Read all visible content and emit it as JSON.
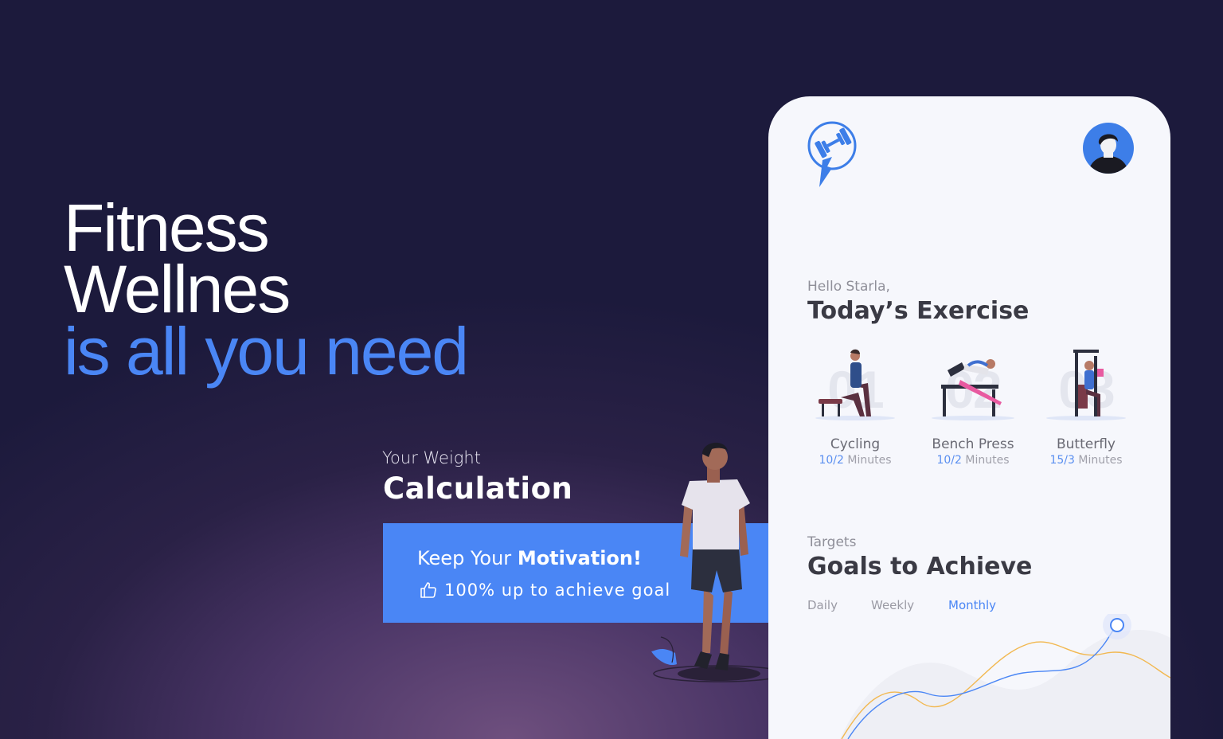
{
  "hero": {
    "line1": "Fitness",
    "line2": "Wellnes",
    "line3": "is all you need",
    "accent_color": "#4a86f5"
  },
  "weight": {
    "label": "Your Weight",
    "title": "Calculation"
  },
  "motivation": {
    "prefix": "Keep Your ",
    "emphasis": "Motivation!",
    "goal_text": "100% up to achieve goal",
    "icon": "thumbs-up-icon"
  },
  "app": {
    "logo_icon": "dumbbell-bolt-logo-icon",
    "avatar_icon": "user-avatar-icon",
    "greeting": "Hello Starla,",
    "exercise_title": "Today’s Exercise",
    "exercises": [
      {
        "number": "01",
        "name": "Cycling",
        "value": "10/2",
        "unit": "Minutes"
      },
      {
        "number": "02",
        "name": "Bench Press",
        "value": "10/2",
        "unit": "Minutes"
      },
      {
        "number": "03",
        "name": "Butterfly",
        "value": "15/3",
        "unit": "Minutes"
      }
    ],
    "targets_label": "Targets",
    "goals_title": "Goals to Achieve",
    "periods": [
      "Daily",
      "Weekly",
      "Monthly"
    ],
    "active_period": "Monthly"
  }
}
